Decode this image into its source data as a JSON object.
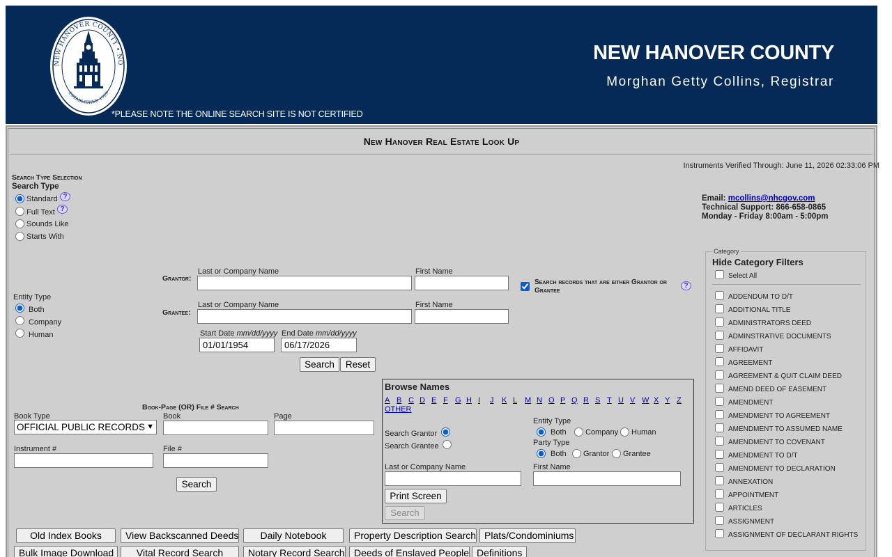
{
  "header": {
    "county": "NEW HANOVER COUNTY",
    "registrar": "Morghan Getty Collins, Registrar",
    "notice": "*PLEASE NOTE THE ONLINE SEARCH SITE IS NOT CERTIFIED",
    "seal_text": "NEW HANOVER COUNTY • NORTH CAROLINA • ESTABLISHED 1729"
  },
  "page_title": "New Hanover Real Estate Look Up",
  "verified": "Instruments Verified Through: June 11, 2026 02:33:06 PM",
  "search_type": {
    "section": "Search Type Selection",
    "heading": "Search Type",
    "options": [
      "Standard",
      "Full Text",
      "Sounds Like",
      "Starts With"
    ],
    "selected": "Standard",
    "help": "?"
  },
  "contact": {
    "email_label": "Email:",
    "email": "mcollins@nhcgov.com",
    "support": "Technical Support: 866-658-0865",
    "hours": "Monday - Friday 8:00am - 5:00pm"
  },
  "entity_type": {
    "label": "Entity Type",
    "options": [
      "Both",
      "Company",
      "Human"
    ],
    "selected": "Both"
  },
  "name_search": {
    "grantor_label": "Grantor:",
    "grantee_label": "Grantee:",
    "last_label": "Last or Company Name",
    "first_label": "First Name",
    "either_label": "Search records that are either Grantor or Grantee",
    "either_checked": true,
    "start_label": "Start Date",
    "end_label": "End Date",
    "date_format": "mm/dd/yyyy",
    "start_value": "01/01/1954",
    "end_value": "06/17/2026",
    "search_btn": "Search",
    "reset_btn": "Reset"
  },
  "book_search": {
    "title": "Book-Page (OR) File # Search",
    "book_type_label": "Book Type",
    "book_type_value": "OFFICIAL PUBLIC RECORDS",
    "book_label": "Book",
    "page_label": "Page",
    "instrument_label": "Instrument #",
    "file_label": "File #",
    "search_btn": "Search"
  },
  "browse": {
    "title": "Browse Names",
    "letters": [
      "A",
      "B",
      "C",
      "D",
      "E",
      "F",
      "G",
      "H",
      "I",
      "J",
      "K",
      "L",
      "M",
      "N",
      "O",
      "P",
      "Q",
      "R",
      "S",
      "T",
      "U",
      "V",
      "W",
      "X",
      "Y",
      "Z"
    ],
    "other": "OTHER",
    "search_grantor": "Search Grantor",
    "search_grantee": "Search Grantee",
    "entity_label": "Entity Type",
    "entity_options": [
      "Both",
      "Company",
      "Human"
    ],
    "party_label": "Party Type",
    "party_options": [
      "Both",
      "Grantor",
      "Grantee"
    ],
    "last_label": "Last or Company Name",
    "first_label": "First Name",
    "print_btn": "Print Screen",
    "search_btn": "Search"
  },
  "category": {
    "legend": "Category",
    "hide": "Hide Category Filters",
    "select_all": "Select All",
    "items": [
      "ADDENDUM TO D/T",
      "ADDITIONAL TITLE",
      "ADMINISTRATORS DEED",
      "ADMINSTRATIVE DOCUMENTS",
      "AFFIDAVIT",
      "AGREEMENT",
      "AGREEMENT & QUIT CLAIM DEED",
      "AMEND DEED OF EASEMENT",
      "AMENDMENT",
      "AMENDMENT TO AGREEMENT",
      "AMENDMENT TO ASSUMED NAME",
      "AMENDMENT TO COVENANT",
      "AMENDMENT TO D/T",
      "AMENDMENT TO DECLARATION",
      "ANNEXATION",
      "APPOINTMENT",
      "ARTICLES",
      "ASSIGNMENT",
      "ASSIGNMENT OF DECLARANT RIGHTS"
    ]
  },
  "bottom_buttons": {
    "row1": [
      "Old Index Books",
      "View Backscanned Deeds",
      "Daily Notebook",
      "Property Description Search",
      "Plats/Condominiums"
    ],
    "row2": [
      "Bulk Image Download",
      "Vital Record Search",
      "Notary Record Search",
      "Deeds of Enslaved People",
      "Definitions"
    ]
  }
}
